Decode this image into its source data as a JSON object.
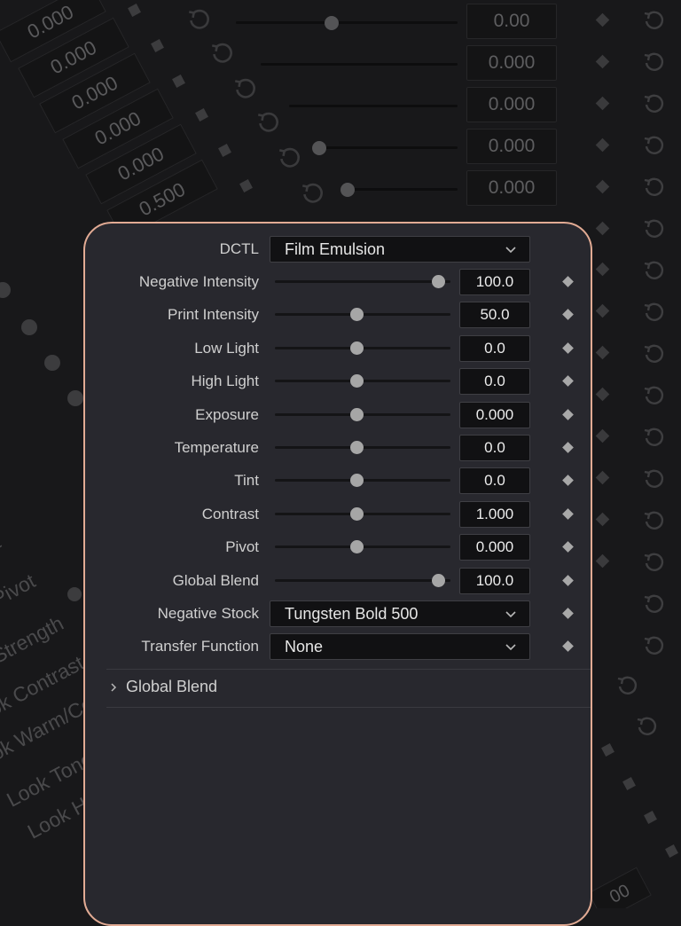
{
  "background": {
    "right_values": [
      "0.00",
      "0.000",
      "0.000",
      "0.000",
      "0.000"
    ],
    "left_values": [
      "0.000",
      "0.000",
      "0.000",
      "0.000",
      "0.000",
      "0.500"
    ],
    "left_labels": [
      "st",
      "Pivot",
      "Strength",
      "ok Contrast",
      "ok Warm/Co",
      "Look Tone C",
      "Look Hu"
    ],
    "bottom_fragment": "00"
  },
  "panel": {
    "dctl": {
      "label": "DCTL",
      "value": "Film Emulsion"
    },
    "sliders": [
      {
        "label": "Negative Intensity",
        "value": "100.0",
        "fraction": 1.0
      },
      {
        "label": "Print Intensity",
        "value": "50.0",
        "fraction": 0.5
      },
      {
        "label": "Low Light",
        "value": "0.0",
        "fraction": 0.5
      },
      {
        "label": "High Light",
        "value": "0.0",
        "fraction": 0.5
      },
      {
        "label": "Exposure",
        "value": "0.000",
        "fraction": 0.5
      },
      {
        "label": "Temperature",
        "value": "0.0",
        "fraction": 0.5
      },
      {
        "label": "Tint",
        "value": "0.0",
        "fraction": 0.5
      },
      {
        "label": "Contrast",
        "value": "1.000",
        "fraction": 0.5
      },
      {
        "label": "Pivot",
        "value": "0.000",
        "fraction": 0.5
      },
      {
        "label": "Global Blend",
        "value": "100.0",
        "fraction": 1.0
      }
    ],
    "negative_stock": {
      "label": "Negative Stock",
      "value": "Tungsten Bold 500"
    },
    "transfer_function": {
      "label": "Transfer Function",
      "value": "None"
    },
    "section": {
      "label": "Global Blend"
    }
  },
  "colors": {
    "panel_border": "#e2ab94",
    "panel_bg": "#28282e",
    "page_bg": "#18181a"
  }
}
